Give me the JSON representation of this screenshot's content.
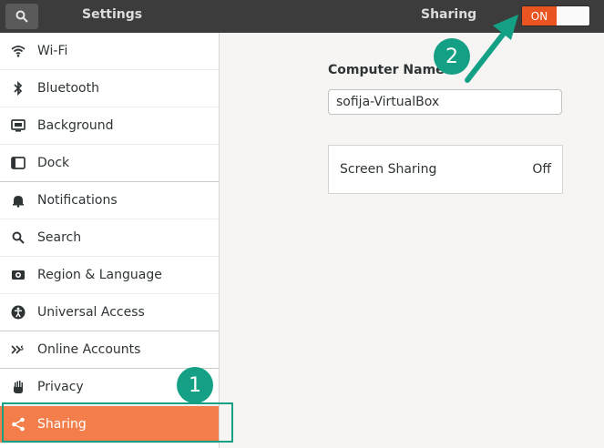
{
  "header": {
    "app_title": "Settings",
    "panel_title": "Sharing",
    "toggle": {
      "state_label": "ON",
      "enabled": true,
      "accent": "#e95420"
    }
  },
  "sidebar": {
    "items": [
      {
        "label": "Wi-Fi",
        "icon": "wifi-icon"
      },
      {
        "label": "Bluetooth",
        "icon": "bluetooth-icon"
      },
      {
        "label": "Background",
        "icon": "background-icon"
      },
      {
        "label": "Dock",
        "icon": "dock-icon"
      },
      {
        "label": "Notifications",
        "icon": "bell-icon"
      },
      {
        "label": "Search",
        "icon": "search-icon"
      },
      {
        "label": "Region & Language",
        "icon": "region-icon"
      },
      {
        "label": "Universal Access",
        "icon": "accessibility-icon"
      },
      {
        "label": "Online Accounts",
        "icon": "online-accounts-icon"
      },
      {
        "label": "Privacy",
        "icon": "hand-icon"
      },
      {
        "label": "Sharing",
        "icon": "share-icon",
        "active": true
      }
    ]
  },
  "main": {
    "computer_name_label": "Computer Name",
    "computer_name_value": "sofija-VirtualBox",
    "rows": [
      {
        "label": "Screen Sharing",
        "value": "Off"
      }
    ]
  },
  "annotations": {
    "step1": "1",
    "step2": "2",
    "color": "#14a085"
  }
}
